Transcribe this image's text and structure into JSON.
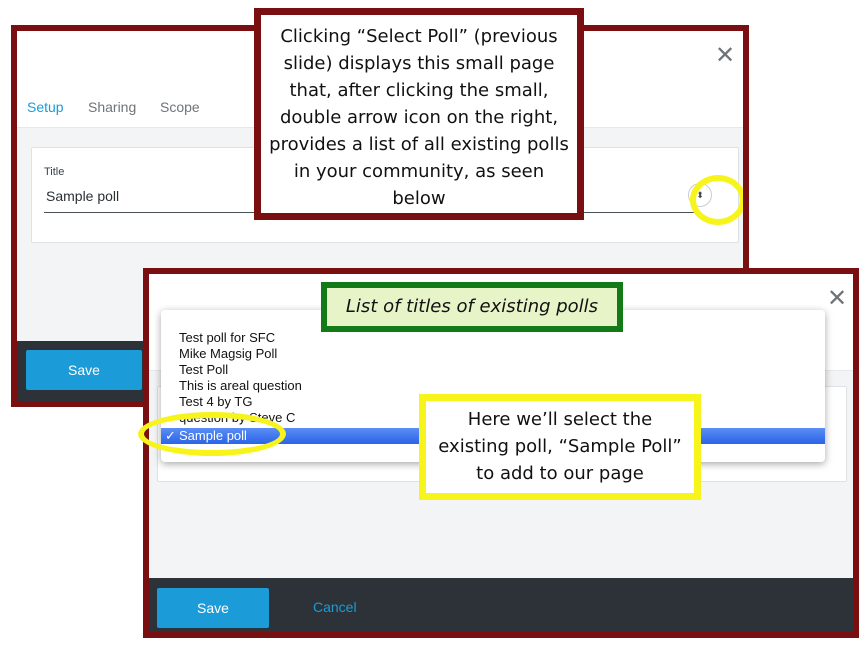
{
  "top_dialog": {
    "tabs": [
      {
        "label": "Setup",
        "active": true
      },
      {
        "label": "Sharing",
        "active": false
      },
      {
        "label": "Scope",
        "active": false
      }
    ],
    "title_label": "Title",
    "title_value": "Sample poll",
    "save_label": "Save",
    "close_glyph": "✕",
    "stepper_glyph": "⬍"
  },
  "callout_top": {
    "text": "Clicking “Select Poll” (previous slide) displays this small page that, after clicking the small, double arrow icon on the right, provides a list of all existing polls in your community, as seen below"
  },
  "bottom_dialog": {
    "close_glyph": "✕",
    "poll_options": [
      "Test poll for SFC",
      "Mike Magsig Poll",
      "Test Poll",
      "This is areal question",
      "Test 4 by TG",
      "        question by Steve C"
    ],
    "selected_option": "Sample poll",
    "selected_check": "✓",
    "save_label": "Save",
    "cancel_label": "Cancel"
  },
  "green_label": {
    "text": "List of titles of existing polls"
  },
  "callout_bottom": {
    "text": "Here we’ll select the existing poll, “Sample Poll” to add to our page"
  },
  "colors": {
    "frame": "#7a0f12",
    "accent": "#1b9bd7",
    "highlight": "#f7f41c",
    "green_border": "#127a17",
    "footer": "#2d3238"
  }
}
